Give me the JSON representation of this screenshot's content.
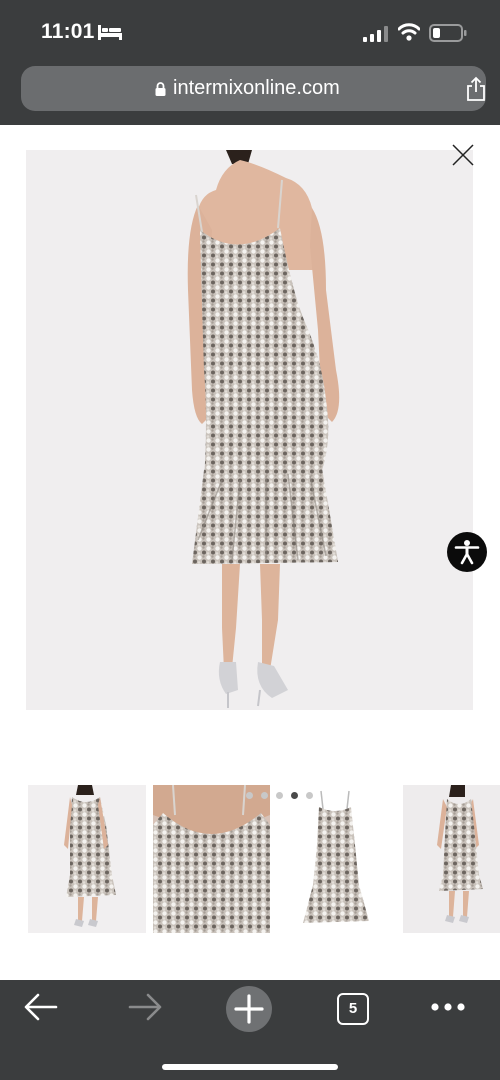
{
  "status_bar": {
    "time": "11:01",
    "icons": [
      "bed-icon",
      "cellular-signal-icon",
      "wifi-icon",
      "battery-icon"
    ]
  },
  "address_bar": {
    "url": "intermixonline.com",
    "icons": [
      "lock-icon",
      "share-icon"
    ]
  },
  "gallery": {
    "close_icon": "close-icon",
    "accessibility_icon": "accessibility-icon",
    "dot_count": 5,
    "active_dot_index": 3,
    "thumbnails": 4
  },
  "toolbar": {
    "tab_count": "5",
    "icons": [
      "back-arrow-icon",
      "forward-arrow-icon",
      "plus-icon",
      "tabs-icon",
      "more-dots-icon"
    ]
  },
  "colors": {
    "chrome_bg": "#3b3d3e",
    "url_field": "#6b6d6f",
    "image_bg": "#f0eeef",
    "accessibility_button": "#0b0b0b"
  }
}
